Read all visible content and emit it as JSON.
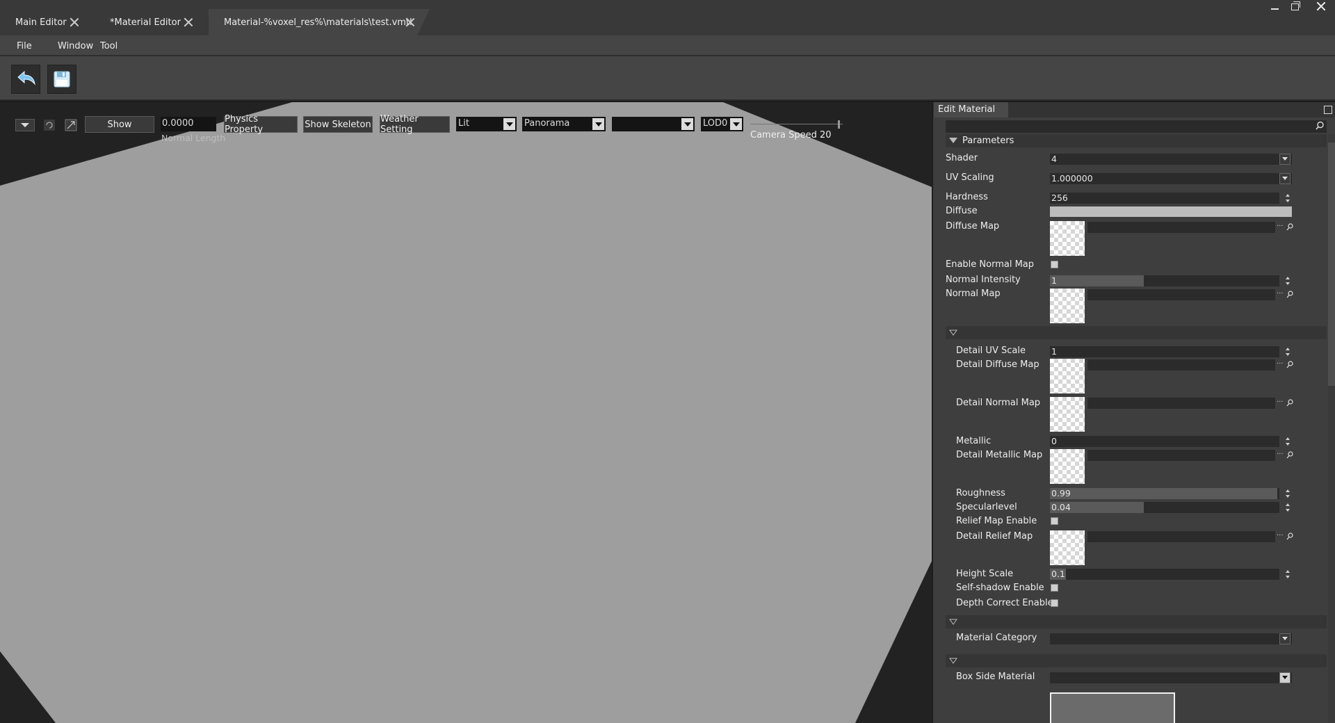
{
  "tabs": [
    {
      "label": "Main Editor",
      "active": false
    },
    {
      "label": "*Material Editor",
      "active": false
    },
    {
      "label": "Material-%voxel_res%\\materials\\test.vmtl",
      "active": true
    }
  ],
  "menu": [
    "File",
    "Window",
    "Tool"
  ],
  "toolbar": {
    "undo_icon": "undo-arrow-icon",
    "save_icon": "floppy-disk-icon"
  },
  "viewport": {
    "show_label": "Show",
    "normal_length_value": "0.0000",
    "normal_length_label": "Normal Length",
    "physics_property_label": "Physics Property",
    "show_skeleton_label": "Show Skeleton",
    "weather_setting_label": "Weather Setting",
    "lighting_mode": "Lit",
    "background_mode": "Panorama",
    "third_select": "",
    "lod": "LOD0",
    "camera_speed_label": "Camera Speed 20",
    "floor_color": "#9e9e9e",
    "bg_color": "#222222"
  },
  "panel": {
    "tab_title": "Edit Material",
    "search_placeholder": "",
    "parameters_title": "Parameters",
    "shader": {
      "label": "Shader",
      "value": "4"
    },
    "uv_scaling": {
      "label": "UV Scaling",
      "value": "1.000000"
    },
    "hardness": {
      "label": "Hardness",
      "value": "256"
    },
    "diffuse": {
      "label": "Diffuse",
      "color": "#bdbdbd"
    },
    "diffuse_map": {
      "label": "Diffuse Map"
    },
    "enable_normal_map": {
      "label": "Enable Normal Map",
      "checked": false
    },
    "normal_intensity": {
      "label": "Normal Intensity",
      "value": "1",
      "fraction": 0.41
    },
    "normal_map": {
      "label": "Normal Map"
    },
    "detail_uv_scale": {
      "label": "Detail UV Scale",
      "value": "1"
    },
    "detail_diffuse_map": {
      "label": "Detail Diffuse Map"
    },
    "detail_normal_map": {
      "label": "Detail Normal Map"
    },
    "metallic": {
      "label": "Metallic",
      "value": "0"
    },
    "detail_metallic_map": {
      "label": "Detail Metallic Map"
    },
    "roughness": {
      "label": "Roughness",
      "value": "0.99",
      "fraction": 0.99
    },
    "specularlevel": {
      "label": "Specularlevel",
      "value": "0.04",
      "fraction": 0.41
    },
    "relief_map_enable": {
      "label": "Relief Map Enable",
      "checked": false
    },
    "detail_relief_map": {
      "label": "Detail Relief Map"
    },
    "height_scale": {
      "label": "Height Scale",
      "value": "0.1",
      "fraction": 0.07
    },
    "self_shadow_enable": {
      "label": "Self-shadow Enable",
      "checked": false
    },
    "depth_correct_enable": {
      "label": "Depth Correct Enable",
      "checked": false
    },
    "material_category": {
      "label": "Material Category",
      "value": ""
    },
    "box_side_material": {
      "label": "Box Side Material",
      "value": ""
    }
  }
}
